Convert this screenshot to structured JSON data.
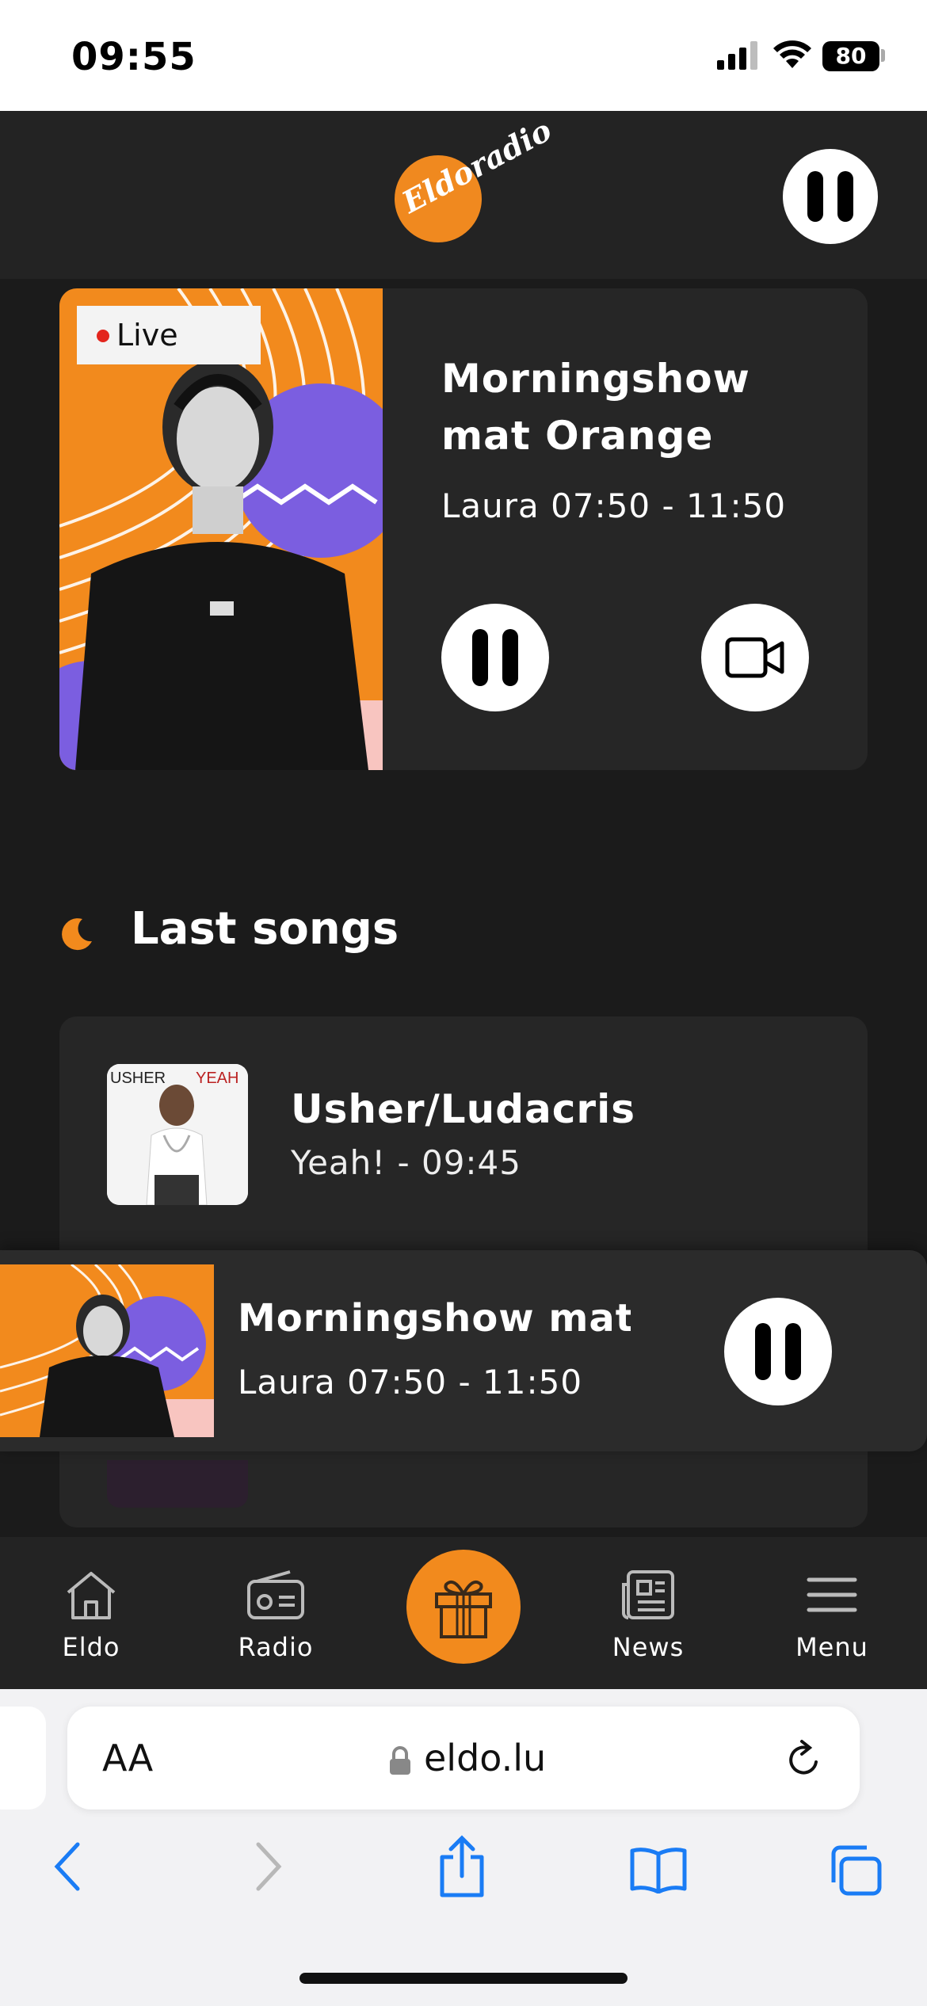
{
  "status_bar": {
    "time": "09:55",
    "battery": "80"
  },
  "header": {
    "logo_text": "Eldoradio",
    "pause_icon": "pause-icon"
  },
  "live_card": {
    "badge": "Live",
    "title": "Morningshow mat Orange",
    "subtitle": "Laura 07:50 - 11:50",
    "video_icon": "video-camera-icon"
  },
  "last_songs": {
    "heading": "Last songs",
    "items": [
      {
        "artist": "Usher/Ludacris",
        "detail": "Yeah! - 09:45",
        "cover_text_left": "USHER",
        "cover_text_right": "YEAH"
      }
    ]
  },
  "mini_player": {
    "title": "Morningshow mat Orange",
    "subtitle": "Laura 07:50 - 11:50"
  },
  "tabbar": {
    "items": [
      {
        "label": "Eldo",
        "icon": "home-icon"
      },
      {
        "label": "Radio",
        "icon": "radio-icon"
      },
      {
        "label": "",
        "icon": "gift-icon"
      },
      {
        "label": "News",
        "icon": "newspaper-icon"
      },
      {
        "label": "Menu",
        "icon": "hamburger-icon"
      }
    ]
  },
  "safari": {
    "aa_label": "AA",
    "url": "eldo.lu"
  },
  "colors": {
    "accent": "#f28a1d",
    "background": "#1b1b1b",
    "card": "#262626",
    "live_dot": "#e3251d",
    "safari_blue": "#1a7cf5"
  }
}
